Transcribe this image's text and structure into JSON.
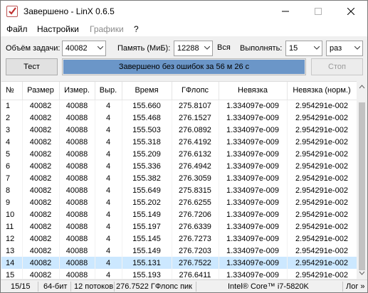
{
  "window": {
    "title": "Завершено - LinX 0.6.5"
  },
  "menu": {
    "file": "Файл",
    "settings": "Настройки",
    "graphs": "Графики",
    "help": "?"
  },
  "toolbar": {
    "problem_size_label": "Объём задачи:",
    "problem_size_value": "40082",
    "memory_label": "Память (МиБ):",
    "memory_value": "12288",
    "all_label": "Вся",
    "run_label": "Выполнять:",
    "run_value": "15",
    "unit_value": "раз",
    "test_button": "Тест",
    "stop_button": "Стоп",
    "progress_text": "Завершено без ошибок за 56 м 26 с",
    "progress_fraction": 1.0
  },
  "table": {
    "headers": [
      "№",
      "Размер",
      "Измер.",
      "Выр.",
      "Время",
      "ГФлопс",
      "Невязка",
      "Невязка (норм.)"
    ],
    "rows": [
      [
        "1",
        "40082",
        "40088",
        "4",
        "155.660",
        "275.8107",
        "1.334097e-009",
        "2.954291e-002"
      ],
      [
        "2",
        "40082",
        "40088",
        "4",
        "155.468",
        "276.1527",
        "1.334097e-009",
        "2.954291e-002"
      ],
      [
        "3",
        "40082",
        "40088",
        "4",
        "155.503",
        "276.0892",
        "1.334097e-009",
        "2.954291e-002"
      ],
      [
        "4",
        "40082",
        "40088",
        "4",
        "155.318",
        "276.4192",
        "1.334097e-009",
        "2.954291e-002"
      ],
      [
        "5",
        "40082",
        "40088",
        "4",
        "155.209",
        "276.6132",
        "1.334097e-009",
        "2.954291e-002"
      ],
      [
        "6",
        "40082",
        "40088",
        "4",
        "155.336",
        "276.4942",
        "1.334097e-009",
        "2.954291e-002"
      ],
      [
        "7",
        "40082",
        "40088",
        "4",
        "155.382",
        "276.3059",
        "1.334097e-009",
        "2.954291e-002"
      ],
      [
        "8",
        "40082",
        "40088",
        "4",
        "155.649",
        "275.8315",
        "1.334097e-009",
        "2.954291e-002"
      ],
      [
        "9",
        "40082",
        "40088",
        "4",
        "155.202",
        "276.6255",
        "1.334097e-009",
        "2.954291e-002"
      ],
      [
        "10",
        "40082",
        "40088",
        "4",
        "155.149",
        "276.7206",
        "1.334097e-009",
        "2.954291e-002"
      ],
      [
        "11",
        "40082",
        "40088",
        "4",
        "155.197",
        "276.6339",
        "1.334097e-009",
        "2.954291e-002"
      ],
      [
        "12",
        "40082",
        "40088",
        "4",
        "155.145",
        "276.7273",
        "1.334097e-009",
        "2.954291e-002"
      ],
      [
        "13",
        "40082",
        "40088",
        "4",
        "155.149",
        "276.7203",
        "1.334097e-009",
        "2.954291e-002"
      ],
      [
        "14",
        "40082",
        "40088",
        "4",
        "155.131",
        "276.7522",
        "1.334097e-009",
        "2.954291e-002"
      ],
      [
        "15",
        "40082",
        "40088",
        "4",
        "155.193",
        "276.6411",
        "1.334097e-009",
        "2.954291e-002"
      ]
    ],
    "selected_row": 13
  },
  "status": {
    "progress": "15/15",
    "bitness": "64-бит",
    "threads": "12 потоков",
    "peak": "276.7522 ГФлопс пик",
    "cpu": "Intel® Core™ i7-5820K",
    "log": "Лог »"
  },
  "colors": {
    "progress_fill": "#6b96c8",
    "selection": "#cce8ff"
  }
}
